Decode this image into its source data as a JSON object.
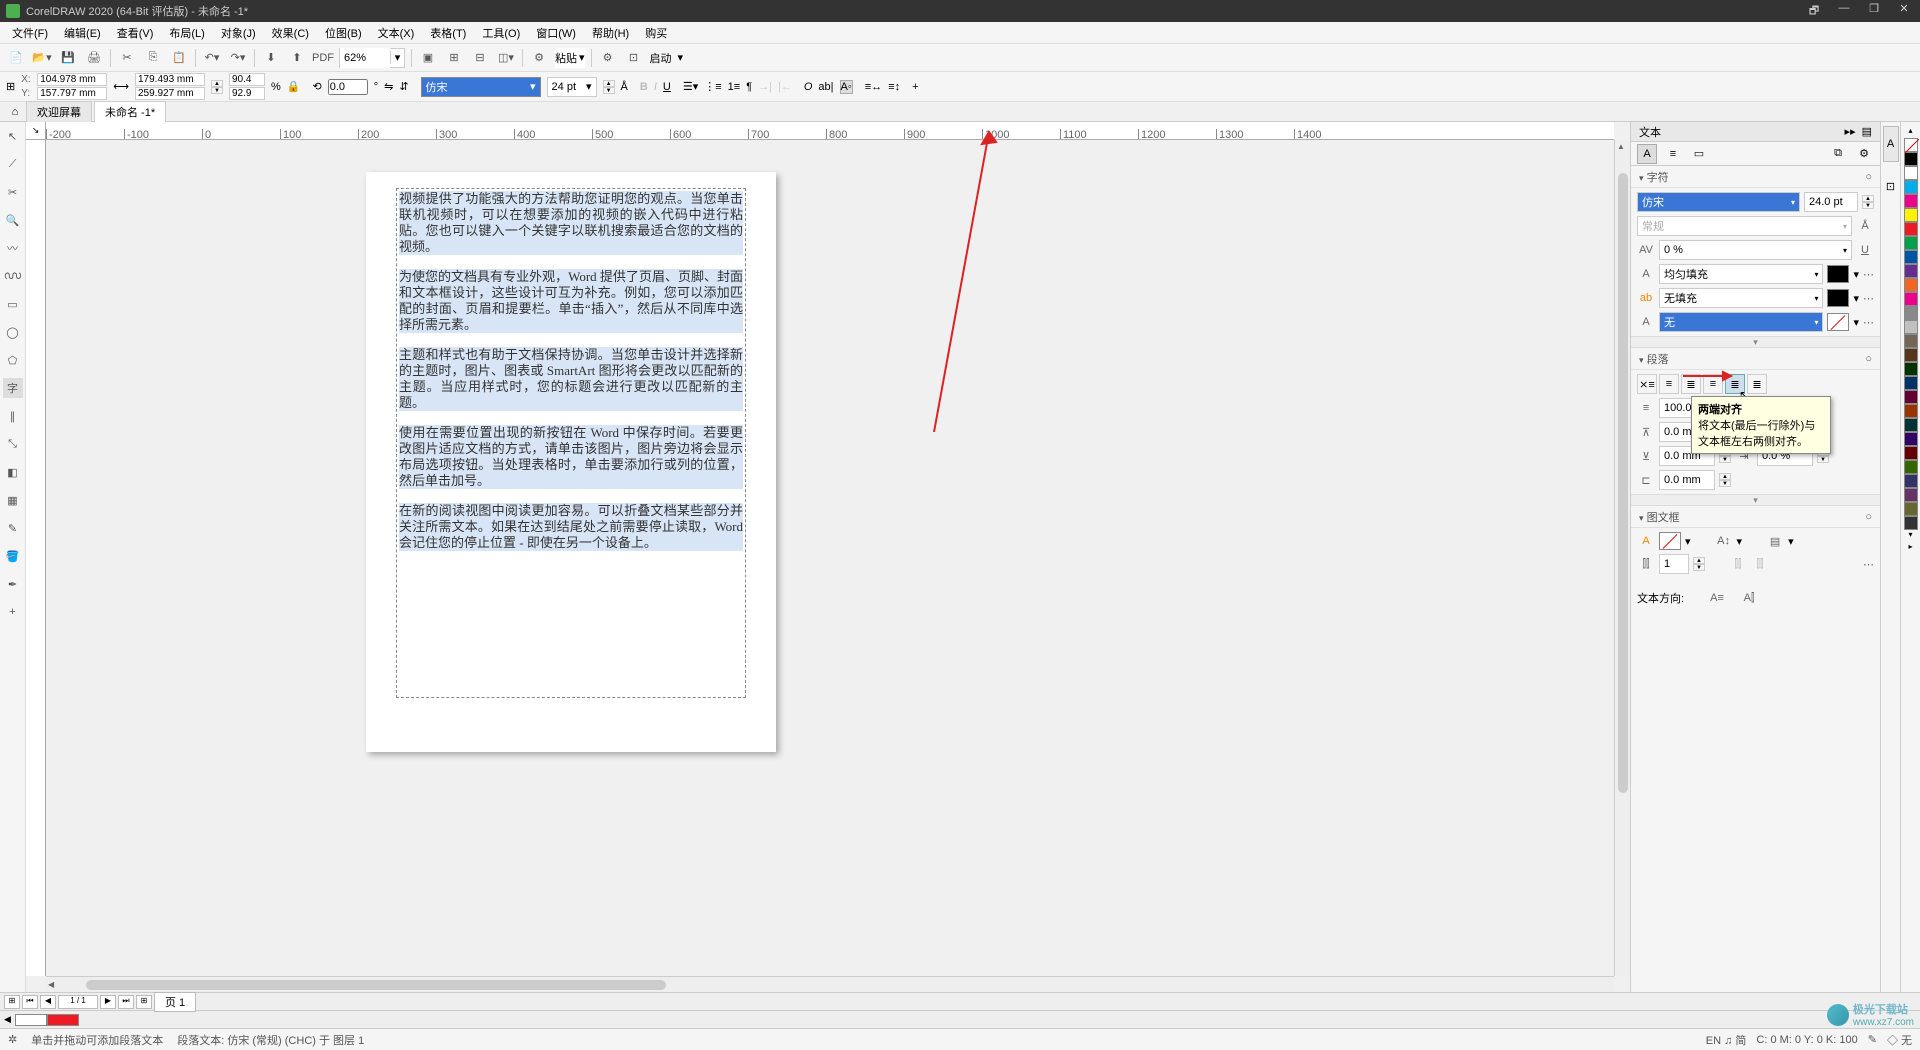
{
  "title_bar": {
    "app_title": "CorelDRAW 2020 (64-Bit 评估版) - 未命名 -1*",
    "win_buttons": {
      "doc": "🗗",
      "min": "—",
      "resize": "❐",
      "close": "✕"
    }
  },
  "menu": {
    "file": "文件(F)",
    "edit": "编辑(E)",
    "view": "查看(V)",
    "layout": "布局(L)",
    "object": "对象(J)",
    "effects": "效果(C)",
    "bitmap": "位图(B)",
    "text": "文本(X)",
    "table": "表格(T)",
    "tools": "工具(O)",
    "window": "窗口(W)",
    "help": "帮助(H)",
    "buy": "购买"
  },
  "toolbar1": {
    "zoom": "62%",
    "paste": "粘贴",
    "launch": "启动"
  },
  "prop": {
    "x": "104.978 mm",
    "y": "157.797 mm",
    "w": "179.493 mm",
    "h": "259.927 mm",
    "sx": "90.4",
    "sy": "92.9",
    "pct": "%",
    "angle": "0.0",
    "deg": "°",
    "font": "仿宋",
    "size": "24 pt"
  },
  "tabs": {
    "welcome": "欢迎屏幕",
    "doc": "未命名 -1*"
  },
  "ruler_marks": [
    "-200",
    "-100",
    "0",
    "100",
    "200",
    "300",
    "400",
    "500",
    "600",
    "700",
    "800",
    "900",
    "1000",
    "1100",
    "1200",
    "1300",
    "1400"
  ],
  "text_content": {
    "p1": "视频提供了功能强大的方法帮助您证明您的观点。当您单击联机视频时，可以在想要添加的视频的嵌入代码中进行粘贴。您也可以键入一个关键字以联机搜索最适合您的文档的视频。",
    "p2": "为使您的文档具有专业外观，Word 提供了页眉、页脚、封面和文本框设计，这些设计可互为补充。例如，您可以添加匹配的封面、页眉和提要栏。单击“插入”，然后从不同库中选择所需元素。",
    "p3": "主题和样式也有助于文档保持协调。当您单击设计并选择新的主题时，图片、图表或 SmartArt 图形将会更改以匹配新的主题。当应用样式时，您的标题会进行更改以匹配新的主题。",
    "p4": "使用在需要位置出现的新按钮在 Word 中保存时间。若要更改图片适应文档的方式，请单击该图片，图片旁边将会显示布局选项按钮。当处理表格时，单击要添加行或列的位置，然后单击加号。",
    "p5": "在新的阅读视图中阅读更加容易。可以折叠文档某些部分并关注所需文本。如果在达到结尾处之前需要停止读取，Word 会记住您的停止位置 - 即使在另一个设备上。"
  },
  "docker": {
    "tab_title": "文本",
    "section_char": "字符",
    "font": "仿宋",
    "size": "24.0 pt",
    "style": "常规",
    "kerning": "0 %",
    "fill_type": "均匀填充",
    "outline_fill": "无填充",
    "outline_a": "无",
    "section_para": "段落",
    "line_spacing": "100.0 %",
    "before": "0.0 mm",
    "after_left": "0.0 mm",
    "after_right": "0.0 %",
    "indent": "0.0 mm",
    "section_frame": "图文框",
    "columns": "1",
    "direction_label": "文本方向:",
    "tooltip_title": "两端对齐",
    "tooltip_body": "将文本(最后一行除外)与文本框左右两侧对齐。"
  },
  "page_nav": {
    "page": "页 1"
  },
  "status": {
    "hint": "单击并拖动可添加段落文本",
    "info": "段落文本: 仿宋 (常规) (CHC) 于 图层 1",
    "ime": "EN ♫ 简",
    "cursor": "C: 0 M: 0 Y: 0 K: 100",
    "fill": "◇ 无"
  },
  "palette": [
    "#000000",
    "#ffffff",
    "#00aeef",
    "#ed008c",
    "#fff200",
    "#ed1c24",
    "#00a14b",
    "#0054a6",
    "#662d91",
    "#f26522",
    "#ec008c",
    "#898989",
    "#c0c0c0",
    "#726658",
    "#56371a",
    "#003300",
    "#003366",
    "#660033",
    "#993300",
    "#003333",
    "#330066",
    "#660000",
    "#336600",
    "#333366",
    "#663366",
    "#666633",
    "#333333"
  ],
  "chip1": "#ffffff",
  "chip2": "#ed1c24",
  "watermark": {
    "name": "极光下载站",
    "url": "www.xz7.com"
  }
}
